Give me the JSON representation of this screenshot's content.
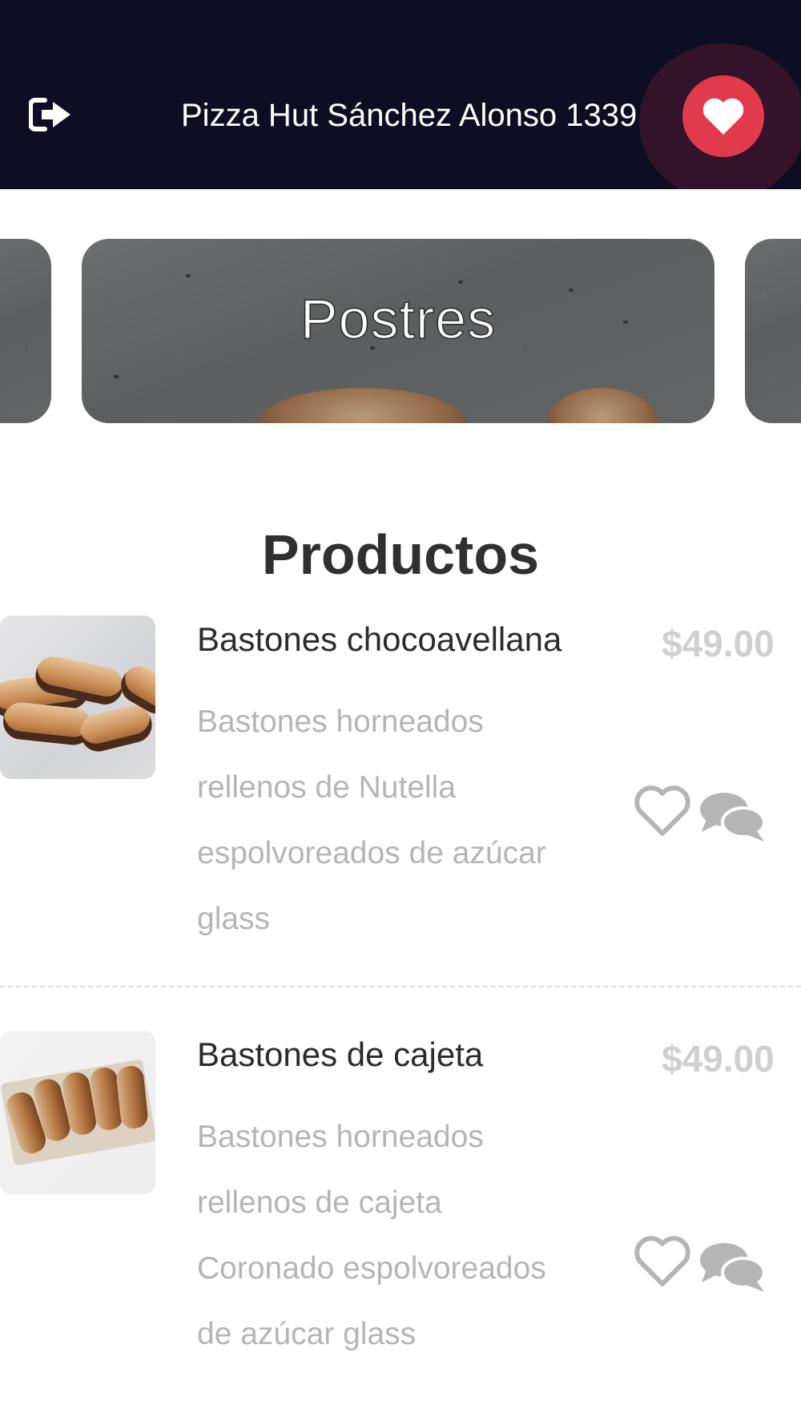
{
  "header": {
    "title": "Pizza Hut Sánchez Alonso 1339",
    "logout_icon": "logout-icon",
    "favorite_icon": "heart-icon"
  },
  "category": {
    "current": "Postres"
  },
  "products_section": {
    "title": "Productos"
  },
  "products": [
    {
      "name": "Bastones chocoavellana",
      "price": "$49.00",
      "description": "Bastones horneados rellenos de Nutella espolvoreados de azúcar glass"
    },
    {
      "name": "Bastones de cajeta",
      "price": "$49.00",
      "description": "Bastones horneados rellenos de cajeta Coronado espolvoreados de azúcar glass"
    }
  ],
  "colors": {
    "header_bg": "#0d0d24",
    "accent": "#e03a4c",
    "price": "#cfcfcf",
    "description": "#b5b5b5"
  }
}
